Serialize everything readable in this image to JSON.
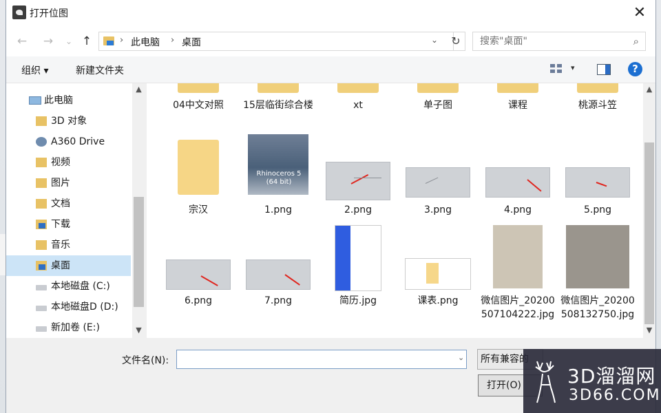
{
  "window": {
    "title": "打开位图",
    "close_glyph": "✕"
  },
  "nav": {
    "back": "←",
    "forward": "→",
    "recent": "⌄",
    "up": "↑"
  },
  "address": {
    "sep1": "›",
    "crumb1": "此电脑",
    "sep2": "›",
    "crumb2": "桌面",
    "dropdown": "⌄",
    "refresh": "↻"
  },
  "search": {
    "placeholder": "搜索\"桌面\"",
    "icon": "⌕"
  },
  "toolbar": {
    "organize": "组织 ▾",
    "new_folder": "新建文件夹",
    "view_dd": "▾",
    "help": "?"
  },
  "sidebar": {
    "items": [
      {
        "label": "此电脑",
        "icon": "pc-icon"
      },
      {
        "label": "3D 对象",
        "icon": "folder-icon"
      },
      {
        "label": "A360 Drive",
        "icon": "cloud-icon"
      },
      {
        "label": "视频",
        "icon": "video-folder-icon"
      },
      {
        "label": "图片",
        "icon": "pictures-folder-icon"
      },
      {
        "label": "文档",
        "icon": "documents-folder-icon"
      },
      {
        "label": "下载",
        "icon": "downloads-folder-icon"
      },
      {
        "label": "音乐",
        "icon": "music-folder-icon"
      },
      {
        "label": "桌面",
        "icon": "desktop-folder-icon"
      },
      {
        "label": "本地磁盘 (C:)",
        "icon": "drive-icon"
      },
      {
        "label": "本地磁盘D (D:)",
        "icon": "drive-icon"
      },
      {
        "label": "新加卷 (E:)",
        "icon": "drive-icon"
      }
    ],
    "selected": "桌面",
    "scroll_up": "▲",
    "scroll_down": "▼"
  },
  "files": {
    "row1": [
      "04中文对照",
      "15层临街综合楼",
      "xt",
      "单子图",
      "课程",
      "桃源斗笠"
    ],
    "row2": [
      "宗汉",
      "1.png",
      "2.png",
      "3.png",
      "4.png",
      "5.png"
    ],
    "row3": [
      "6.png",
      "7.png",
      "简历.jpg",
      "课表.png",
      "微信图片_20200507104222.jpg",
      "微信图片_20200508132750.jpg"
    ],
    "rhino_caption": "Rhinoceros 5 (64 bit)"
  },
  "bottom": {
    "filename_label": "文件名(N):",
    "filename_value": "",
    "filename_dd": "⌄",
    "filetype": "所有兼容的",
    "open_button": "打开(O)"
  },
  "watermark": {
    "brand": "3D溜溜网",
    "domain": "3D66.COM"
  },
  "colors": {
    "accent": "#1c6fd1",
    "selection": "#cce4f7",
    "folder": "#f0cf7a",
    "red_line": "#e0261f"
  }
}
